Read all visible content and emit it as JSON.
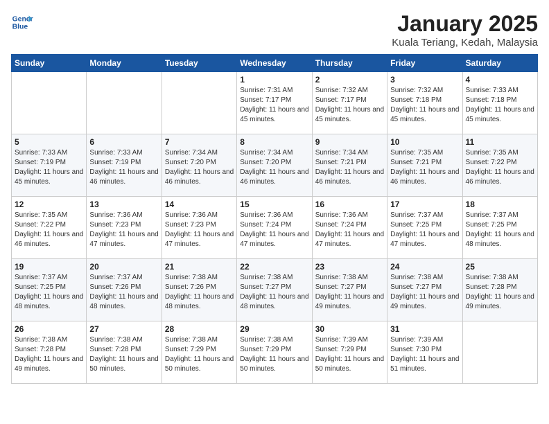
{
  "logo": {
    "line1": "General",
    "line2": "Blue"
  },
  "title": "January 2025",
  "subtitle": "Kuala Teriang, Kedah, Malaysia",
  "days_of_week": [
    "Sunday",
    "Monday",
    "Tuesday",
    "Wednesday",
    "Thursday",
    "Friday",
    "Saturday"
  ],
  "weeks": [
    [
      {
        "day": "",
        "sunrise": "",
        "sunset": "",
        "daylight": ""
      },
      {
        "day": "",
        "sunrise": "",
        "sunset": "",
        "daylight": ""
      },
      {
        "day": "",
        "sunrise": "",
        "sunset": "",
        "daylight": ""
      },
      {
        "day": "1",
        "sunrise": "Sunrise: 7:31 AM",
        "sunset": "Sunset: 7:17 PM",
        "daylight": "Daylight: 11 hours and 45 minutes."
      },
      {
        "day": "2",
        "sunrise": "Sunrise: 7:32 AM",
        "sunset": "Sunset: 7:17 PM",
        "daylight": "Daylight: 11 hours and 45 minutes."
      },
      {
        "day": "3",
        "sunrise": "Sunrise: 7:32 AM",
        "sunset": "Sunset: 7:18 PM",
        "daylight": "Daylight: 11 hours and 45 minutes."
      },
      {
        "day": "4",
        "sunrise": "Sunrise: 7:33 AM",
        "sunset": "Sunset: 7:18 PM",
        "daylight": "Daylight: 11 hours and 45 minutes."
      }
    ],
    [
      {
        "day": "5",
        "sunrise": "Sunrise: 7:33 AM",
        "sunset": "Sunset: 7:19 PM",
        "daylight": "Daylight: 11 hours and 45 minutes."
      },
      {
        "day": "6",
        "sunrise": "Sunrise: 7:33 AM",
        "sunset": "Sunset: 7:19 PM",
        "daylight": "Daylight: 11 hours and 46 minutes."
      },
      {
        "day": "7",
        "sunrise": "Sunrise: 7:34 AM",
        "sunset": "Sunset: 7:20 PM",
        "daylight": "Daylight: 11 hours and 46 minutes."
      },
      {
        "day": "8",
        "sunrise": "Sunrise: 7:34 AM",
        "sunset": "Sunset: 7:20 PM",
        "daylight": "Daylight: 11 hours and 46 minutes."
      },
      {
        "day": "9",
        "sunrise": "Sunrise: 7:34 AM",
        "sunset": "Sunset: 7:21 PM",
        "daylight": "Daylight: 11 hours and 46 minutes."
      },
      {
        "day": "10",
        "sunrise": "Sunrise: 7:35 AM",
        "sunset": "Sunset: 7:21 PM",
        "daylight": "Daylight: 11 hours and 46 minutes."
      },
      {
        "day": "11",
        "sunrise": "Sunrise: 7:35 AM",
        "sunset": "Sunset: 7:22 PM",
        "daylight": "Daylight: 11 hours and 46 minutes."
      }
    ],
    [
      {
        "day": "12",
        "sunrise": "Sunrise: 7:35 AM",
        "sunset": "Sunset: 7:22 PM",
        "daylight": "Daylight: 11 hours and 46 minutes."
      },
      {
        "day": "13",
        "sunrise": "Sunrise: 7:36 AM",
        "sunset": "Sunset: 7:23 PM",
        "daylight": "Daylight: 11 hours and 47 minutes."
      },
      {
        "day": "14",
        "sunrise": "Sunrise: 7:36 AM",
        "sunset": "Sunset: 7:23 PM",
        "daylight": "Daylight: 11 hours and 47 minutes."
      },
      {
        "day": "15",
        "sunrise": "Sunrise: 7:36 AM",
        "sunset": "Sunset: 7:24 PM",
        "daylight": "Daylight: 11 hours and 47 minutes."
      },
      {
        "day": "16",
        "sunrise": "Sunrise: 7:36 AM",
        "sunset": "Sunset: 7:24 PM",
        "daylight": "Daylight: 11 hours and 47 minutes."
      },
      {
        "day": "17",
        "sunrise": "Sunrise: 7:37 AM",
        "sunset": "Sunset: 7:25 PM",
        "daylight": "Daylight: 11 hours and 47 minutes."
      },
      {
        "day": "18",
        "sunrise": "Sunrise: 7:37 AM",
        "sunset": "Sunset: 7:25 PM",
        "daylight": "Daylight: 11 hours and 48 minutes."
      }
    ],
    [
      {
        "day": "19",
        "sunrise": "Sunrise: 7:37 AM",
        "sunset": "Sunset: 7:25 PM",
        "daylight": "Daylight: 11 hours and 48 minutes."
      },
      {
        "day": "20",
        "sunrise": "Sunrise: 7:37 AM",
        "sunset": "Sunset: 7:26 PM",
        "daylight": "Daylight: 11 hours and 48 minutes."
      },
      {
        "day": "21",
        "sunrise": "Sunrise: 7:38 AM",
        "sunset": "Sunset: 7:26 PM",
        "daylight": "Daylight: 11 hours and 48 minutes."
      },
      {
        "day": "22",
        "sunrise": "Sunrise: 7:38 AM",
        "sunset": "Sunset: 7:27 PM",
        "daylight": "Daylight: 11 hours and 48 minutes."
      },
      {
        "day": "23",
        "sunrise": "Sunrise: 7:38 AM",
        "sunset": "Sunset: 7:27 PM",
        "daylight": "Daylight: 11 hours and 49 minutes."
      },
      {
        "day": "24",
        "sunrise": "Sunrise: 7:38 AM",
        "sunset": "Sunset: 7:27 PM",
        "daylight": "Daylight: 11 hours and 49 minutes."
      },
      {
        "day": "25",
        "sunrise": "Sunrise: 7:38 AM",
        "sunset": "Sunset: 7:28 PM",
        "daylight": "Daylight: 11 hours and 49 minutes."
      }
    ],
    [
      {
        "day": "26",
        "sunrise": "Sunrise: 7:38 AM",
        "sunset": "Sunset: 7:28 PM",
        "daylight": "Daylight: 11 hours and 49 minutes."
      },
      {
        "day": "27",
        "sunrise": "Sunrise: 7:38 AM",
        "sunset": "Sunset: 7:28 PM",
        "daylight": "Daylight: 11 hours and 50 minutes."
      },
      {
        "day": "28",
        "sunrise": "Sunrise: 7:38 AM",
        "sunset": "Sunset: 7:29 PM",
        "daylight": "Daylight: 11 hours and 50 minutes."
      },
      {
        "day": "29",
        "sunrise": "Sunrise: 7:38 AM",
        "sunset": "Sunset: 7:29 PM",
        "daylight": "Daylight: 11 hours and 50 minutes."
      },
      {
        "day": "30",
        "sunrise": "Sunrise: 7:39 AM",
        "sunset": "Sunset: 7:29 PM",
        "daylight": "Daylight: 11 hours and 50 minutes."
      },
      {
        "day": "31",
        "sunrise": "Sunrise: 7:39 AM",
        "sunset": "Sunset: 7:30 PM",
        "daylight": "Daylight: 11 hours and 51 minutes."
      },
      {
        "day": "",
        "sunrise": "",
        "sunset": "",
        "daylight": ""
      }
    ]
  ]
}
